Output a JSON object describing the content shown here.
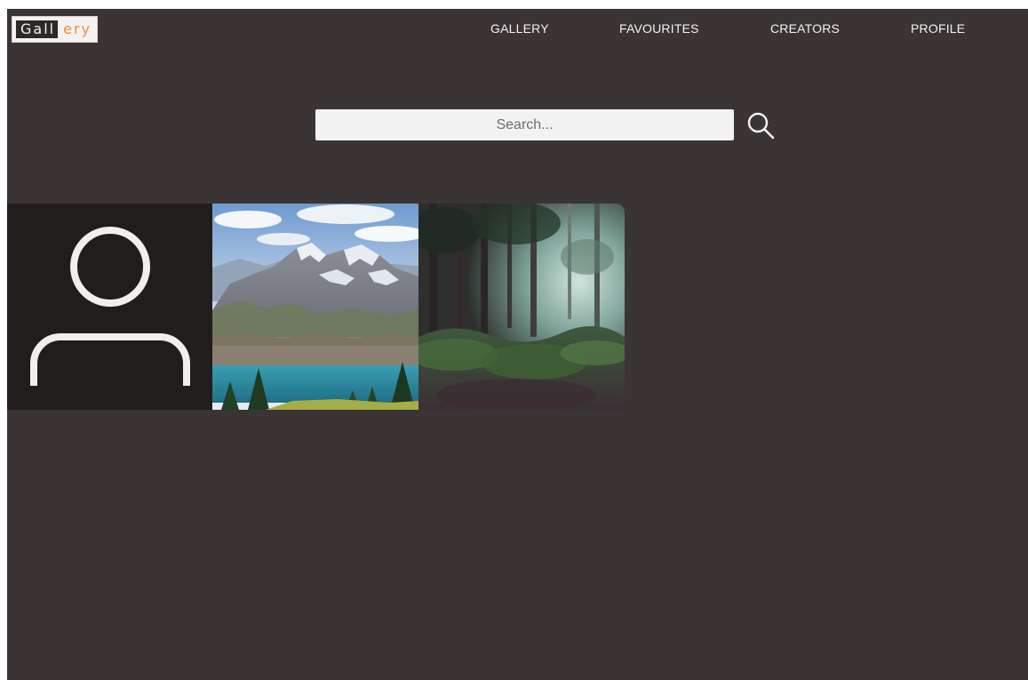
{
  "header": {
    "logo": {
      "part_a": "Gall",
      "part_b": "ery"
    },
    "nav": [
      {
        "label": "GALLERY"
      },
      {
        "label": "FAVOURITES"
      },
      {
        "label": "CREATORS"
      },
      {
        "label": "PROFILE"
      }
    ]
  },
  "search": {
    "placeholder": "Search...",
    "value": "",
    "icon": "search-icon"
  },
  "gallery": {
    "tiles": [
      {
        "name": "profile-tile",
        "icon": "user-icon"
      },
      {
        "name": "mountain-lake-photo"
      },
      {
        "name": "forest-photo"
      }
    ]
  },
  "colors": {
    "background": "#3a3434",
    "logo_accent": "#f08a3c",
    "nav_text": "#f3f3f3",
    "search_field": "#f3f2f2"
  }
}
